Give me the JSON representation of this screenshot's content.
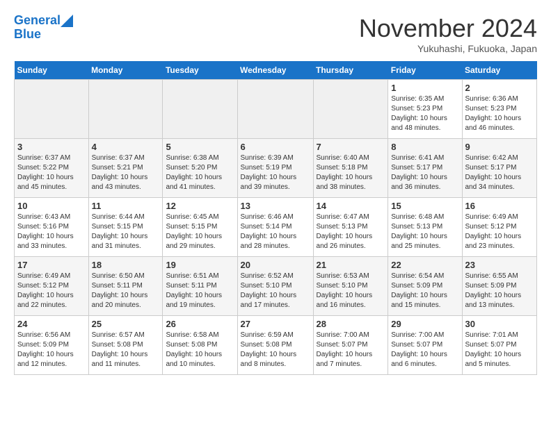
{
  "header": {
    "logo_line1": "General",
    "logo_line2": "Blue",
    "month": "November 2024",
    "location": "Yukuhashi, Fukuoka, Japan"
  },
  "weekdays": [
    "Sunday",
    "Monday",
    "Tuesday",
    "Wednesday",
    "Thursday",
    "Friday",
    "Saturday"
  ],
  "weeks": [
    [
      {
        "day": "",
        "info": ""
      },
      {
        "day": "",
        "info": ""
      },
      {
        "day": "",
        "info": ""
      },
      {
        "day": "",
        "info": ""
      },
      {
        "day": "",
        "info": ""
      },
      {
        "day": "1",
        "info": "Sunrise: 6:35 AM\nSunset: 5:23 PM\nDaylight: 10 hours\nand 48 minutes."
      },
      {
        "day": "2",
        "info": "Sunrise: 6:36 AM\nSunset: 5:23 PM\nDaylight: 10 hours\nand 46 minutes."
      }
    ],
    [
      {
        "day": "3",
        "info": "Sunrise: 6:37 AM\nSunset: 5:22 PM\nDaylight: 10 hours\nand 45 minutes."
      },
      {
        "day": "4",
        "info": "Sunrise: 6:37 AM\nSunset: 5:21 PM\nDaylight: 10 hours\nand 43 minutes."
      },
      {
        "day": "5",
        "info": "Sunrise: 6:38 AM\nSunset: 5:20 PM\nDaylight: 10 hours\nand 41 minutes."
      },
      {
        "day": "6",
        "info": "Sunrise: 6:39 AM\nSunset: 5:19 PM\nDaylight: 10 hours\nand 39 minutes."
      },
      {
        "day": "7",
        "info": "Sunrise: 6:40 AM\nSunset: 5:18 PM\nDaylight: 10 hours\nand 38 minutes."
      },
      {
        "day": "8",
        "info": "Sunrise: 6:41 AM\nSunset: 5:17 PM\nDaylight: 10 hours\nand 36 minutes."
      },
      {
        "day": "9",
        "info": "Sunrise: 6:42 AM\nSunset: 5:17 PM\nDaylight: 10 hours\nand 34 minutes."
      }
    ],
    [
      {
        "day": "10",
        "info": "Sunrise: 6:43 AM\nSunset: 5:16 PM\nDaylight: 10 hours\nand 33 minutes."
      },
      {
        "day": "11",
        "info": "Sunrise: 6:44 AM\nSunset: 5:15 PM\nDaylight: 10 hours\nand 31 minutes."
      },
      {
        "day": "12",
        "info": "Sunrise: 6:45 AM\nSunset: 5:15 PM\nDaylight: 10 hours\nand 29 minutes."
      },
      {
        "day": "13",
        "info": "Sunrise: 6:46 AM\nSunset: 5:14 PM\nDaylight: 10 hours\nand 28 minutes."
      },
      {
        "day": "14",
        "info": "Sunrise: 6:47 AM\nSunset: 5:13 PM\nDaylight: 10 hours\nand 26 minutes."
      },
      {
        "day": "15",
        "info": "Sunrise: 6:48 AM\nSunset: 5:13 PM\nDaylight: 10 hours\nand 25 minutes."
      },
      {
        "day": "16",
        "info": "Sunrise: 6:49 AM\nSunset: 5:12 PM\nDaylight: 10 hours\nand 23 minutes."
      }
    ],
    [
      {
        "day": "17",
        "info": "Sunrise: 6:49 AM\nSunset: 5:12 PM\nDaylight: 10 hours\nand 22 minutes."
      },
      {
        "day": "18",
        "info": "Sunrise: 6:50 AM\nSunset: 5:11 PM\nDaylight: 10 hours\nand 20 minutes."
      },
      {
        "day": "19",
        "info": "Sunrise: 6:51 AM\nSunset: 5:11 PM\nDaylight: 10 hours\nand 19 minutes."
      },
      {
        "day": "20",
        "info": "Sunrise: 6:52 AM\nSunset: 5:10 PM\nDaylight: 10 hours\nand 17 minutes."
      },
      {
        "day": "21",
        "info": "Sunrise: 6:53 AM\nSunset: 5:10 PM\nDaylight: 10 hours\nand 16 minutes."
      },
      {
        "day": "22",
        "info": "Sunrise: 6:54 AM\nSunset: 5:09 PM\nDaylight: 10 hours\nand 15 minutes."
      },
      {
        "day": "23",
        "info": "Sunrise: 6:55 AM\nSunset: 5:09 PM\nDaylight: 10 hours\nand 13 minutes."
      }
    ],
    [
      {
        "day": "24",
        "info": "Sunrise: 6:56 AM\nSunset: 5:09 PM\nDaylight: 10 hours\nand 12 minutes."
      },
      {
        "day": "25",
        "info": "Sunrise: 6:57 AM\nSunset: 5:08 PM\nDaylight: 10 hours\nand 11 minutes."
      },
      {
        "day": "26",
        "info": "Sunrise: 6:58 AM\nSunset: 5:08 PM\nDaylight: 10 hours\nand 10 minutes."
      },
      {
        "day": "27",
        "info": "Sunrise: 6:59 AM\nSunset: 5:08 PM\nDaylight: 10 hours\nand 8 minutes."
      },
      {
        "day": "28",
        "info": "Sunrise: 7:00 AM\nSunset: 5:07 PM\nDaylight: 10 hours\nand 7 minutes."
      },
      {
        "day": "29",
        "info": "Sunrise: 7:00 AM\nSunset: 5:07 PM\nDaylight: 10 hours\nand 6 minutes."
      },
      {
        "day": "30",
        "info": "Sunrise: 7:01 AM\nSunset: 5:07 PM\nDaylight: 10 hours\nand 5 minutes."
      }
    ]
  ]
}
